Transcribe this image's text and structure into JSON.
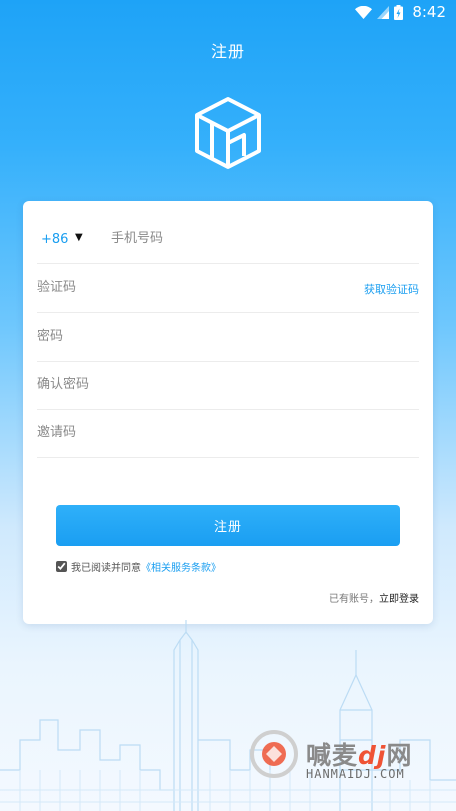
{
  "status_bar": {
    "time": "8:42",
    "icons": [
      "wifi-icon",
      "signal-icon",
      "battery-icon"
    ]
  },
  "header": {
    "title": "注册",
    "logo": "box-logo-icon"
  },
  "form": {
    "country_code": "+86",
    "phone_placeholder": "手机号码",
    "code_placeholder": "验证码",
    "get_code_label": "获取验证码",
    "password_placeholder": "密码",
    "confirm_password_placeholder": "确认密码",
    "invite_code_placeholder": "邀请码",
    "submit_label": "注册",
    "agreement_checked": true,
    "agreement_prefix": "我已阅读并同意",
    "terms_link": "《相关服务条款》",
    "login_prompt": "已有账号，",
    "login_link": "立即登录"
  },
  "watermark": {
    "brand_main": "喊麦",
    "brand_accent": "dj",
    "brand_suffix": "网",
    "domain": "HANMAIDJ.COM"
  },
  "colors": {
    "accent": "#1a9ef0",
    "background_top": "#1ea3f7",
    "background_bottom": "#f4f9ff",
    "card": "#ffffff"
  }
}
